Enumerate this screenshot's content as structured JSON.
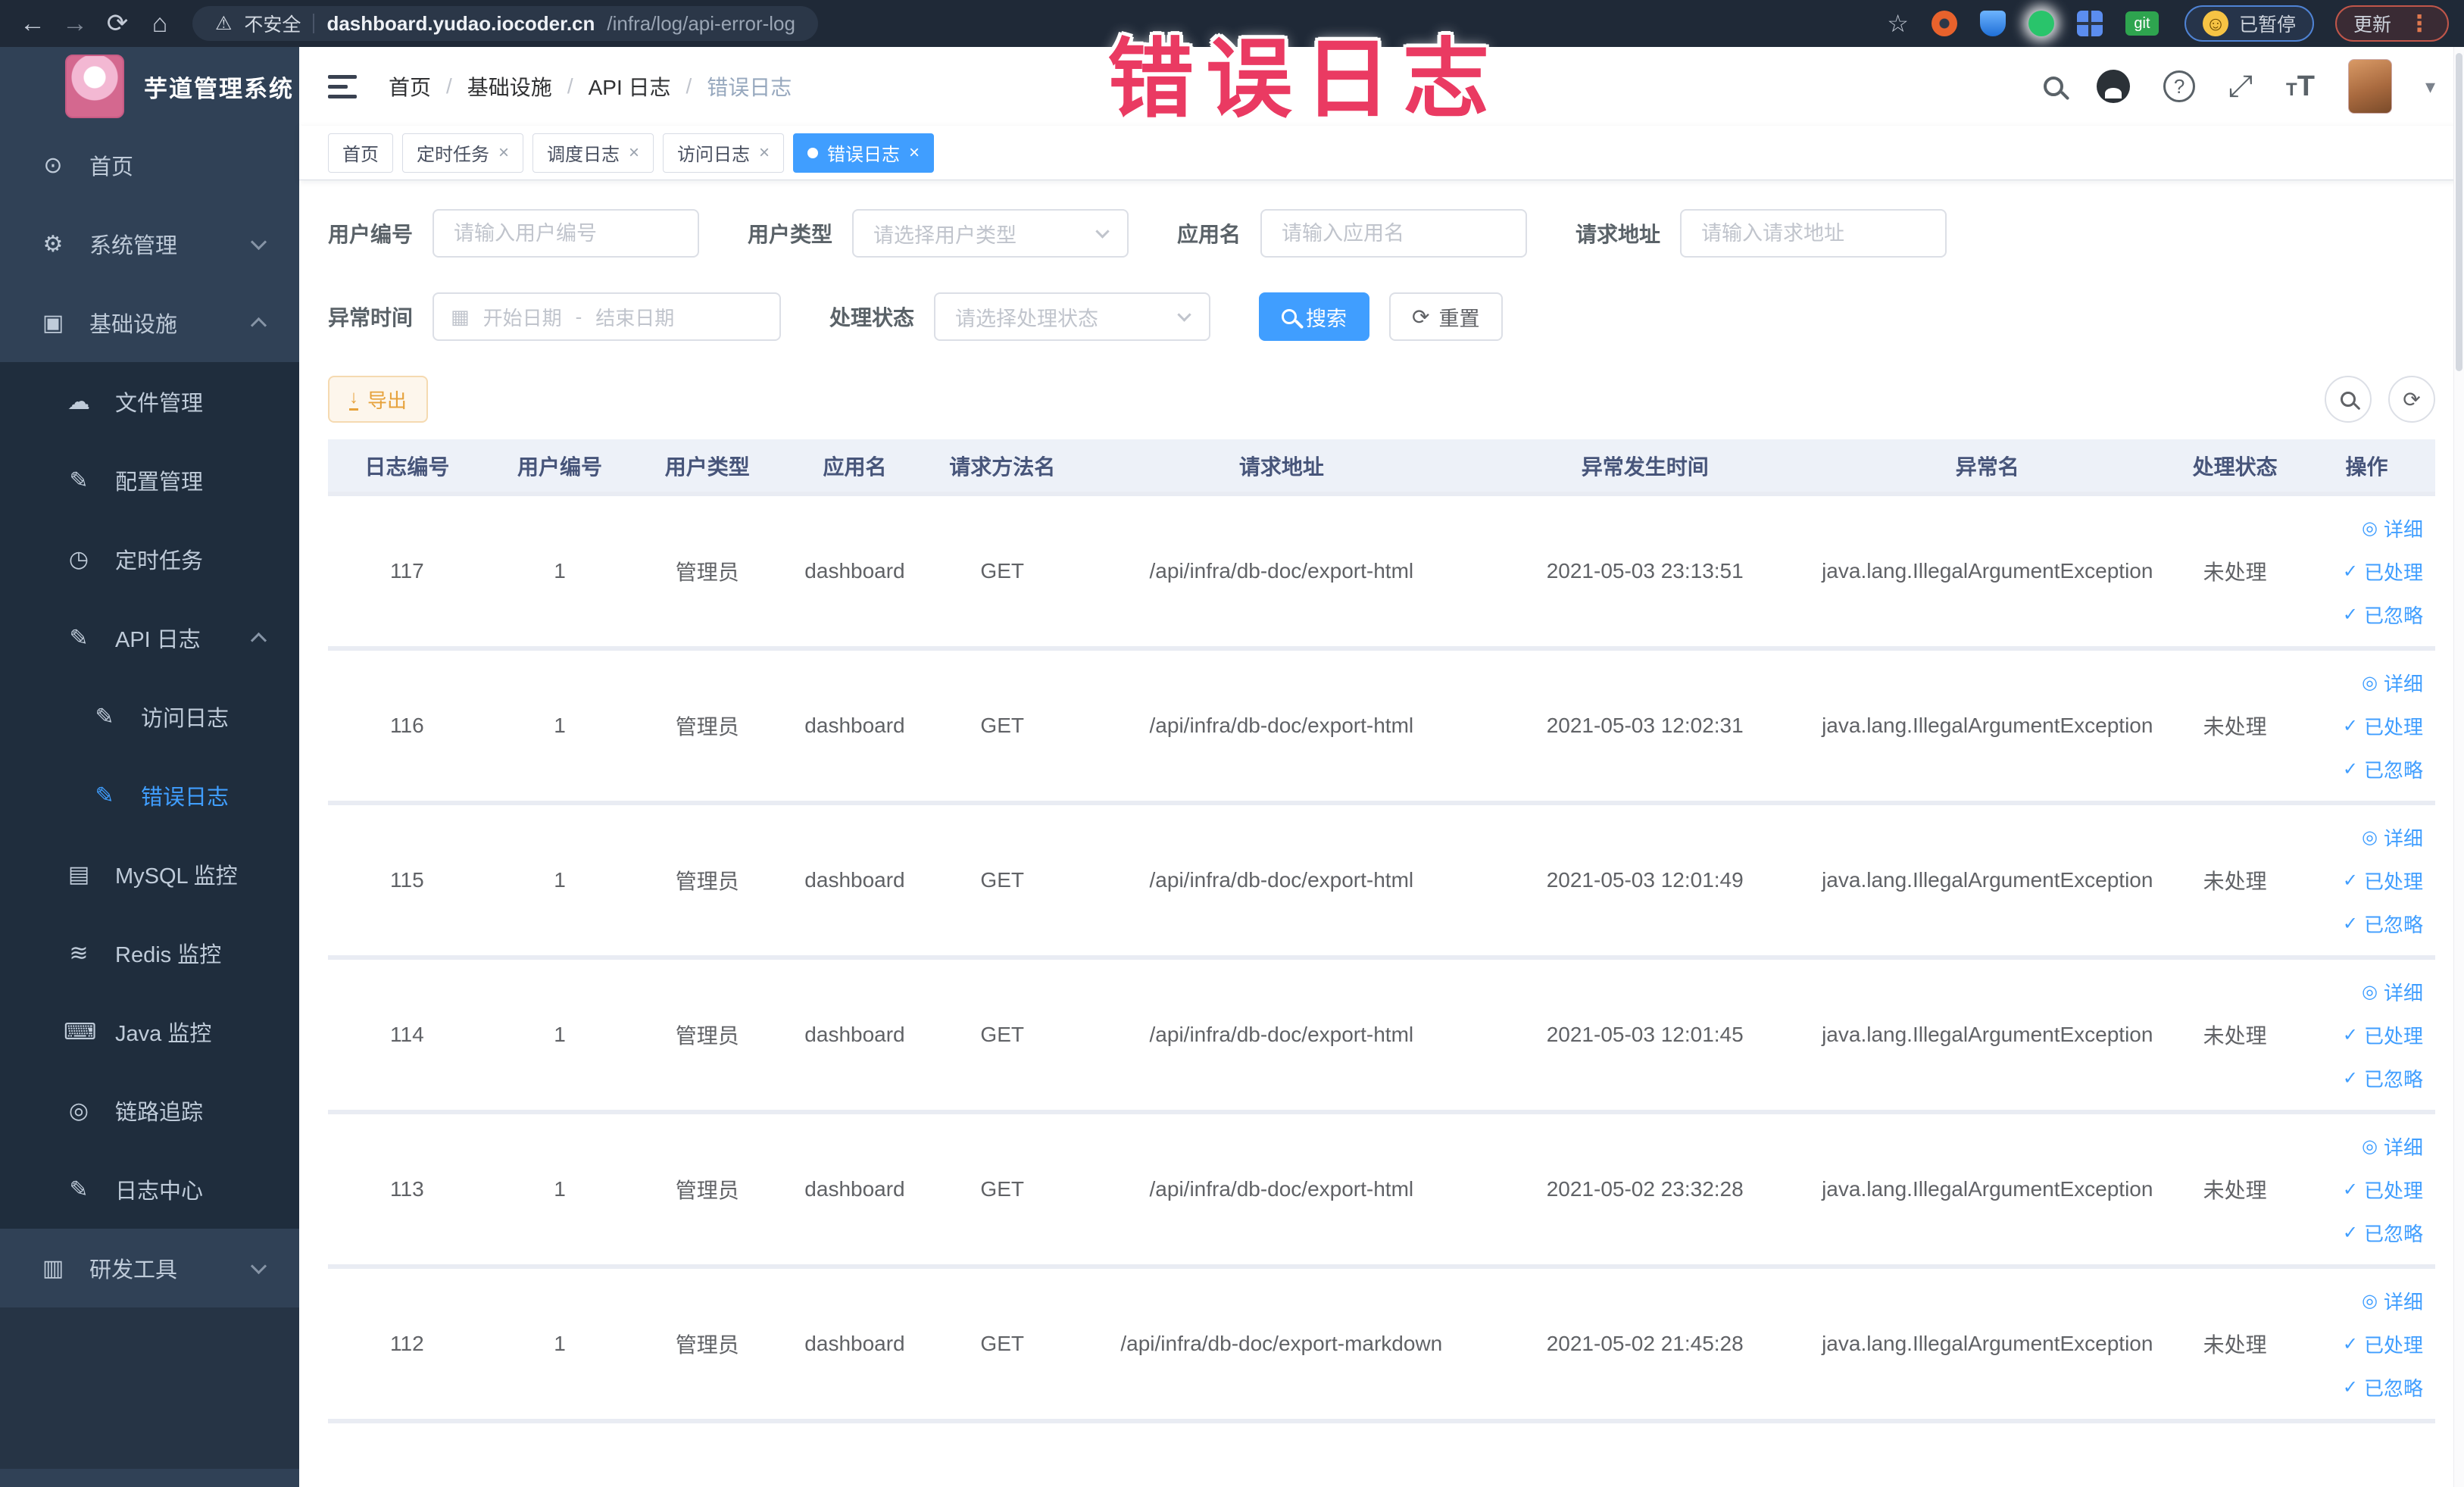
{
  "browser": {
    "security_label": "不安全",
    "url_host": "dashboard.yudao.iocoder.cn",
    "url_path": "/infra/log/api-error-log",
    "paused_badge": "已暂停",
    "update_label": "更新",
    "extension_git_text": "git"
  },
  "overlay": {
    "title": "错误日志"
  },
  "sidebar": {
    "app_title": "芋道管理系统",
    "items": [
      {
        "name": "home",
        "label": "首页",
        "icon": "dashboard-icon",
        "level": 0
      },
      {
        "name": "system-management",
        "label": "系统管理",
        "icon": "gear-icon",
        "level": 0,
        "chevron": "down"
      },
      {
        "name": "infrastructure",
        "label": "基础设施",
        "icon": "monitor-icon",
        "level": 0,
        "chevron": "up"
      },
      {
        "name": "file-management",
        "label": "文件管理",
        "icon": "cloud-upload-icon",
        "level": 1
      },
      {
        "name": "config-management",
        "label": "配置管理",
        "icon": "edit-icon",
        "level": 1
      },
      {
        "name": "scheduled-tasks",
        "label": "定时任务",
        "icon": "timer-icon",
        "level": 1
      },
      {
        "name": "api-log",
        "label": "API 日志",
        "icon": "document-edit-icon",
        "level": 1,
        "chevron": "up"
      },
      {
        "name": "access-log",
        "label": "访问日志",
        "icon": "document-edit-icon",
        "level": 2
      },
      {
        "name": "error-log",
        "label": "错误日志",
        "icon": "document-edit-icon",
        "level": 2,
        "active": true
      },
      {
        "name": "mysql-monitor",
        "label": "MySQL 监控",
        "icon": "database-icon",
        "level": 1
      },
      {
        "name": "redis-monitor",
        "label": "Redis 监控",
        "icon": "layers-icon",
        "level": 1
      },
      {
        "name": "java-monitor",
        "label": "Java 监控",
        "icon": "terminal-icon",
        "level": 1
      },
      {
        "name": "trace",
        "label": "链路追踪",
        "icon": "eye-icon",
        "level": 1
      },
      {
        "name": "log-center",
        "label": "日志中心",
        "icon": "document-edit-icon",
        "level": 1
      },
      {
        "name": "dev-tools",
        "label": "研发工具",
        "icon": "briefcase-icon",
        "level": 0,
        "chevron": "down"
      }
    ]
  },
  "header": {
    "breadcrumb": [
      {
        "label": "首页"
      },
      {
        "label": "基础设施"
      },
      {
        "label": "API 日志"
      },
      {
        "label": "错误日志",
        "current": true
      }
    ],
    "separator": "/"
  },
  "tabs": [
    {
      "label": "首页",
      "closable": false,
      "active": false
    },
    {
      "label": "定时任务",
      "closable": true,
      "active": false
    },
    {
      "label": "调度日志",
      "closable": true,
      "active": false
    },
    {
      "label": "访问日志",
      "closable": true,
      "active": false
    },
    {
      "label": "错误日志",
      "closable": true,
      "active": true
    }
  ],
  "filters": {
    "user_id": {
      "label": "用户编号",
      "placeholder": "请输入用户编号"
    },
    "user_type": {
      "label": "用户类型",
      "placeholder": "请选择用户类型"
    },
    "app_name": {
      "label": "应用名",
      "placeholder": "请输入应用名"
    },
    "request_url": {
      "label": "请求地址",
      "placeholder": "请输入请求地址"
    },
    "exception_time": {
      "label": "异常时间",
      "start_placeholder": "开始日期",
      "separator": "-",
      "end_placeholder": "结束日期"
    },
    "process_status": {
      "label": "处理状态",
      "placeholder": "请选择处理状态"
    },
    "search_label": "搜索",
    "reset_label": "重置"
  },
  "toolbar": {
    "export_label": "导出"
  },
  "table": {
    "columns": [
      {
        "key": "log_id",
        "label": "日志编号"
      },
      {
        "key": "user_id",
        "label": "用户编号"
      },
      {
        "key": "user_type",
        "label": "用户类型"
      },
      {
        "key": "app_name",
        "label": "应用名"
      },
      {
        "key": "method",
        "label": "请求方法名"
      },
      {
        "key": "url",
        "label": "请求地址"
      },
      {
        "key": "time",
        "label": "异常发生时间"
      },
      {
        "key": "exception",
        "label": "异常名"
      },
      {
        "key": "status",
        "label": "处理状态"
      },
      {
        "key": "actions",
        "label": "操作"
      }
    ],
    "row_actions": [
      {
        "name": "detail",
        "label": "详细",
        "icon": "eye-icon"
      },
      {
        "name": "mark-processed",
        "label": "已处理",
        "icon": "check-icon"
      },
      {
        "name": "mark-ignored",
        "label": "已忽略",
        "icon": "check-icon"
      }
    ],
    "rows": [
      {
        "log_id": "117",
        "user_id": "1",
        "user_type": "管理员",
        "app_name": "dashboard",
        "method": "GET",
        "url": "/api/infra/db-doc/export-html",
        "time": "2021-05-03 23:13:51",
        "exception": "java.lang.IllegalArgumentException",
        "status": "未处理"
      },
      {
        "log_id": "116",
        "user_id": "1",
        "user_type": "管理员",
        "app_name": "dashboard",
        "method": "GET",
        "url": "/api/infra/db-doc/export-html",
        "time": "2021-05-03 12:02:31",
        "exception": "java.lang.IllegalArgumentException",
        "status": "未处理"
      },
      {
        "log_id": "115",
        "user_id": "1",
        "user_type": "管理员",
        "app_name": "dashboard",
        "method": "GET",
        "url": "/api/infra/db-doc/export-html",
        "time": "2021-05-03 12:01:49",
        "exception": "java.lang.IllegalArgumentException",
        "status": "未处理"
      },
      {
        "log_id": "114",
        "user_id": "1",
        "user_type": "管理员",
        "app_name": "dashboard",
        "method": "GET",
        "url": "/api/infra/db-doc/export-html",
        "time": "2021-05-03 12:01:45",
        "exception": "java.lang.IllegalArgumentException",
        "status": "未处理"
      },
      {
        "log_id": "113",
        "user_id": "1",
        "user_type": "管理员",
        "app_name": "dashboard",
        "method": "GET",
        "url": "/api/infra/db-doc/export-html",
        "time": "2021-05-02 23:32:28",
        "exception": "java.lang.IllegalArgumentException",
        "status": "未处理"
      },
      {
        "log_id": "112",
        "user_id": "1",
        "user_type": "管理员",
        "app_name": "dashboard",
        "method": "GET",
        "url": "/api/infra/db-doc/export-markdown",
        "time": "2021-05-02 21:45:28",
        "exception": "java.lang.IllegalArgumentException",
        "status": "未处理"
      }
    ]
  },
  "colors": {
    "primary": "#409eff",
    "warning": "#e6a23c",
    "sidebar_bg": "#304156",
    "submenu_bg": "#1f2d3d",
    "overlay_pink": "#ea3a62"
  }
}
